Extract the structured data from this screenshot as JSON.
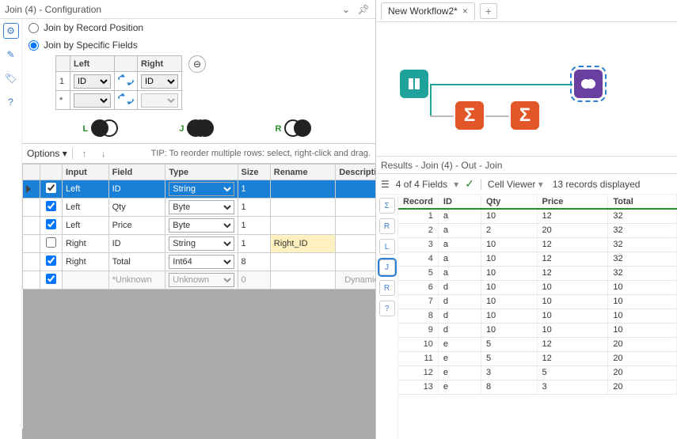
{
  "config": {
    "title": "Join (4) - Configuration",
    "radio": {
      "by_position": "Join by Record Position",
      "by_fields": "Join by Specific Fields",
      "selected": "by_fields"
    },
    "join_fields": {
      "headers": {
        "left": "Left",
        "right": "Right"
      },
      "rows": [
        {
          "idx": "1",
          "left": "ID",
          "right": "ID"
        },
        {
          "idx": "*",
          "left": "",
          "right": ""
        }
      ]
    },
    "venn": {
      "l": "L",
      "j": "J",
      "r": "R"
    },
    "options_label": "Options",
    "tip": "TIP: To reorder multiple rows: select, right-click and drag.",
    "grid": {
      "headers": [
        "",
        "",
        "Input",
        "Field",
        "Type",
        "Size",
        "Rename",
        "Description"
      ],
      "rows": [
        {
          "sel": true,
          "chk": true,
          "input": "Left",
          "field": "ID",
          "type": "String",
          "size": "1",
          "rename": "",
          "desc": ""
        },
        {
          "sel": false,
          "chk": true,
          "input": "Left",
          "field": "Qty",
          "type": "Byte",
          "size": "1",
          "rename": "",
          "desc": ""
        },
        {
          "sel": false,
          "chk": true,
          "input": "Left",
          "field": "Price",
          "type": "Byte",
          "size": "1",
          "rename": "",
          "desc": ""
        },
        {
          "sel": false,
          "chk": false,
          "input": "Right",
          "field": "ID",
          "type": "String",
          "size": "1",
          "rename": "Right_ID",
          "desc": ""
        },
        {
          "sel": false,
          "chk": true,
          "input": "Right",
          "field": "Total",
          "type": "Int64",
          "size": "8",
          "rename": "",
          "desc": ""
        },
        {
          "sel": false,
          "chk": true,
          "input": "",
          "field": "*Unknown",
          "type": "Unknown",
          "size": "0",
          "rename": "",
          "desc": "Dynamic",
          "muted": true
        }
      ]
    }
  },
  "workflow": {
    "tab_label": "New Workflow2*"
  },
  "results": {
    "header": "Results - Join (4) - Out - Join",
    "fields_summary": "4 of 4 Fields",
    "cell_viewer": "Cell Viewer",
    "records_text": "13 records displayed",
    "side_buttons": [
      "Σ",
      "R",
      "L",
      "J",
      "R",
      "?"
    ],
    "columns": [
      "Record",
      "ID",
      "Qty",
      "Price",
      "Total"
    ],
    "rows": [
      {
        "r": 1,
        "id": "a",
        "qty": 10,
        "price": 12,
        "total": 32
      },
      {
        "r": 2,
        "id": "a",
        "qty": 2,
        "price": 20,
        "total": 32
      },
      {
        "r": 3,
        "id": "a",
        "qty": 10,
        "price": 12,
        "total": 32
      },
      {
        "r": 4,
        "id": "a",
        "qty": 10,
        "price": 12,
        "total": 32
      },
      {
        "r": 5,
        "id": "a",
        "qty": 10,
        "price": 12,
        "total": 32
      },
      {
        "r": 6,
        "id": "d",
        "qty": 10,
        "price": 10,
        "total": 10
      },
      {
        "r": 7,
        "id": "d",
        "qty": 10,
        "price": 10,
        "total": 10
      },
      {
        "r": 8,
        "id": "d",
        "qty": 10,
        "price": 10,
        "total": 10
      },
      {
        "r": 9,
        "id": "d",
        "qty": 10,
        "price": 10,
        "total": 10
      },
      {
        "r": 10,
        "id": "e",
        "qty": 5,
        "price": 12,
        "total": 20
      },
      {
        "r": 11,
        "id": "e",
        "qty": 5,
        "price": 12,
        "total": 20
      },
      {
        "r": 12,
        "id": "e",
        "qty": 3,
        "price": 5,
        "total": 20
      },
      {
        "r": 13,
        "id": "e",
        "qty": 8,
        "price": 3,
        "total": 20
      }
    ]
  }
}
